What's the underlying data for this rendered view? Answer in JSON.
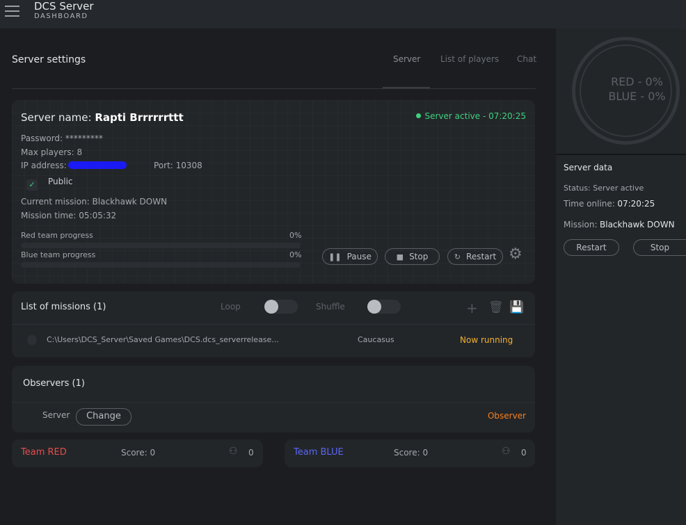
{
  "header": {
    "title": "DCS Server",
    "subtitle": "DASHBOARD"
  },
  "main": {
    "title": "Server settings",
    "tabs": [
      {
        "label": "Server",
        "active": true
      },
      {
        "label": "List of players",
        "active": false
      },
      {
        "label": "Chat",
        "active": false
      }
    ]
  },
  "server": {
    "name_label": "Server name:",
    "name": "Rapti Brrrrrrttt",
    "status": "Server active - 07:20:25",
    "password": "Password: *********",
    "max_players": "Max players: 8",
    "ip_label": "IP address:",
    "port": "Port: 10308",
    "public_label": "Public",
    "public_checked": true,
    "current_mission": "Current mission: Blackhawk DOWN",
    "mission_time": "Mission time: 05:05:32",
    "red_progress_label": "Red team progress",
    "red_progress": 0,
    "red_progress_text": "0%",
    "blue_progress_label": "Blue team progress",
    "blue_progress": 0,
    "blue_progress_text": "0%",
    "pause_label": "Pause",
    "stop_label": "Stop",
    "restart_label": "Restart"
  },
  "missions": {
    "title": "List of missions (1)",
    "loop_label": "Loop",
    "loop_on": false,
    "shuffle_label": "Shuffle",
    "shuffle_on": false,
    "items": [
      {
        "path": "C:\\Users\\DCS_Server\\Saved Games\\DCS.dcs_serverrelease...",
        "map": "Caucasus",
        "status": "Now running"
      }
    ]
  },
  "observers": {
    "title": "Observers (1)",
    "items": [
      {
        "name": "Server",
        "change_label": "Change",
        "role": "Observer"
      }
    ]
  },
  "teams": {
    "red": {
      "name": "Team RED",
      "score": "Score: 0",
      "count": "0",
      "color": "#e84c4c"
    },
    "blue": {
      "name": "Team BLUE",
      "score": "Score: 0",
      "count": "0",
      "color": "#5a67f2"
    }
  },
  "side": {
    "red_pct": "RED - 0%",
    "blue_pct": "BLUE - 0%",
    "title": "Server data",
    "status_label": "Status:",
    "status_value": "Server active",
    "time_label": "Time online:",
    "time_value": "07:20:25",
    "mission_label": "Mission:",
    "mission_value": "Blackhawk DOWN",
    "restart_label": "Restart",
    "stop_label": "Stop"
  }
}
